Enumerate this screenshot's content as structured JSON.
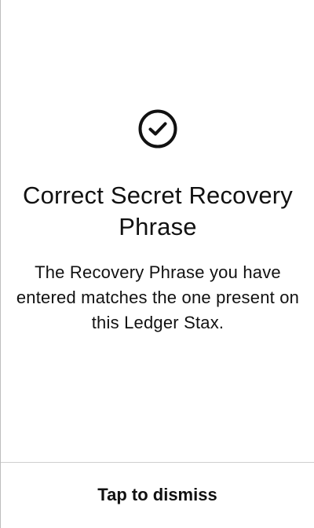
{
  "screen": {
    "icon": "check-circle-icon",
    "title": "Correct Secret Recovery Phrase",
    "description": "The Recovery Phrase you have entered matches the one present on this Ledger Stax.",
    "dismiss_label": "Tap to dismiss"
  },
  "colors": {
    "background": "#ffffff",
    "text": "#111111",
    "divider": "#cfcfcf",
    "left_border": "#bdbdbd"
  }
}
